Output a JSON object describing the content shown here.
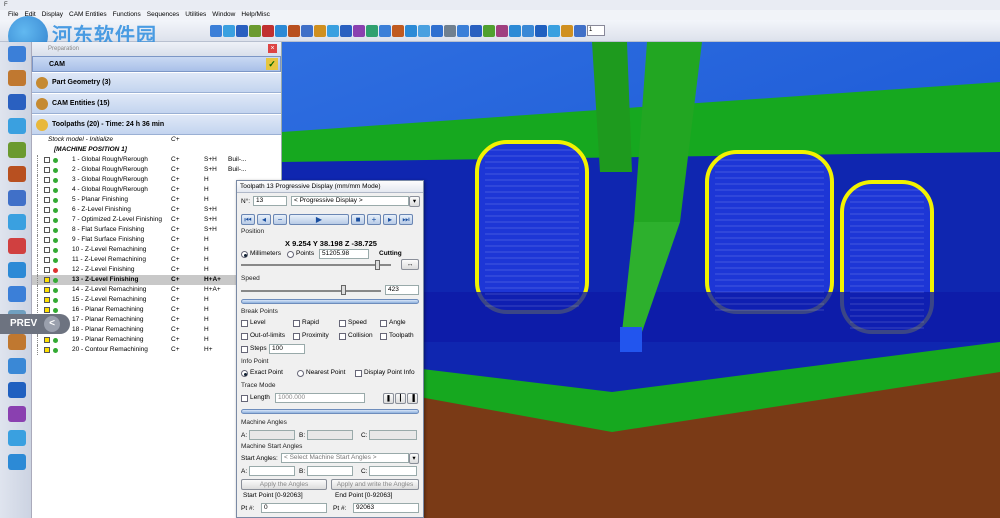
{
  "window": {
    "title_glyph": "F"
  },
  "menu": [
    "File",
    "Edit",
    "Display",
    "CAM Entities",
    "Functions",
    "Sequences",
    "Utilities",
    "Window",
    "Help/Misc"
  ],
  "toolbar": {
    "zoom_value": "1"
  },
  "watermark": {
    "title": "河东软件园",
    "url": "www.pc0359.cn"
  },
  "manager": {
    "header": "Preparation",
    "cam": "CAM",
    "groups": {
      "part_geometry": "Part Geometry (3)",
      "cam_entities": "CAM Entities (15)",
      "toolpaths": "Toolpaths (20) - Time: 24 h 36 min"
    },
    "stock": {
      "name": "Stock model - Initialize",
      "col": "C+"
    },
    "machine_position": "[MACHINE POSITION 1]",
    "rows": [
      {
        "name": "1 - Global Rough/Rerough",
        "c1": "C+",
        "c2": "S+H",
        "c3": "Buil-..."
      },
      {
        "name": "2 - Global Rough/Rerough",
        "c1": "C+",
        "c2": "S+H",
        "c3": "Buil-..."
      },
      {
        "name": "3 - Global Rough/Rerough",
        "c1": "C+",
        "c2": "H",
        "c3": ""
      },
      {
        "name": "4 - Global Rough/Rerough",
        "c1": "C+",
        "c2": "H",
        "c3": ""
      },
      {
        "name": "5 - Planar Finishing",
        "c1": "C+",
        "c2": "H",
        "c3": ""
      },
      {
        "name": "6 - Z-Level Finishing",
        "c1": "C+",
        "c2": "S+H",
        "c3": ""
      },
      {
        "name": "7 - Optimized Z-Level Finishing",
        "c1": "C+",
        "c2": "S+H",
        "c3": ""
      },
      {
        "name": "8 - Flat Surface Finishing",
        "c1": "C+",
        "c2": "S+H",
        "c3": ""
      },
      {
        "name": "9 - Flat Surface Finishing",
        "c1": "C+",
        "c2": "H",
        "c3": ""
      },
      {
        "name": "10 - Z-Level Remachining",
        "c1": "C+",
        "c2": "H",
        "c3": ""
      },
      {
        "name": "11 - Z-Level Remachining",
        "c1": "C+",
        "c2": "H",
        "c3": ""
      },
      {
        "name": "12 - Z-Level Finishing",
        "c1": "C+",
        "c2": "H",
        "c3": ""
      },
      {
        "name": "13 - Z-Level Finishing",
        "c1": "C+",
        "c2": "H+A+",
        "c3": ""
      },
      {
        "name": "14 - Z-Level Remachining",
        "c1": "C+",
        "c2": "H+A+",
        "c3": ""
      },
      {
        "name": "15 - Z-Level Remachining",
        "c1": "C+",
        "c2": "H",
        "c3": ""
      },
      {
        "name": "16 - Planar Remachining",
        "c1": "C+",
        "c2": "H",
        "c3": ""
      },
      {
        "name": "17 - Planar Remachining",
        "c1": "C+",
        "c2": "H",
        "c3": ""
      },
      {
        "name": "18 - Planar Remachining",
        "c1": "C+",
        "c2": "H",
        "c3": ""
      },
      {
        "name": "19 - Planar Remachining",
        "c1": "C+",
        "c2": "H",
        "c3": ""
      },
      {
        "name": "20 - Contour Remachining",
        "c1": "C+",
        "c2": "H+",
        "c3": ""
      }
    ]
  },
  "prev": {
    "label": "PREV",
    "arrow": "<"
  },
  "dialog": {
    "title": "Toolpath 13 Progressive Display (mm/mm Mode)",
    "n_label": "N°:",
    "n_value": "13",
    "mode_value": "< Progressive Display >",
    "position_label": "Position",
    "position_value": "X 9.254 Y 38.198 Z -38.725",
    "millimeters": "Millimeters",
    "points": "Points",
    "points_value": "51205.98",
    "cutting": "Cutting",
    "speed_label": "Speed",
    "speed_value": "423",
    "break_points": "Break Points",
    "bp": [
      "Level",
      "Rapid",
      "Speed",
      "Angle",
      "Out-of-limits",
      "Proximity",
      "Collision",
      "Toolpath"
    ],
    "steps_label": "Steps",
    "steps_value": "100",
    "info_point": "Info Point",
    "exact_point": "Exact Point",
    "nearest_point": "Nearest Point",
    "display_point_info": "Display Point Info",
    "trace_mode": "Trace Mode",
    "length_label": "Length",
    "length_value": "1000.000",
    "machine_angles": "Machine Angles",
    "a": "A:",
    "b": "B:",
    "c": "C:",
    "machine_start_angles": "Machine Start Angles",
    "start_angles_label": "Start Angles:",
    "start_angles_value": "< Select Machine Start Angles >",
    "apply_angles": "Apply the Angles",
    "apply_write": "Apply and write the Angles",
    "start_point": "Start Point [0-92063]",
    "end_point": "End Point [0-92063]",
    "pt_label": "Pt #:",
    "start_pt_value": "0",
    "end_pt_value": "92063"
  },
  "colors": {
    "part_blue": "#1d3fd6",
    "stock_green": "#18b020",
    "toolpath_yellow": "#f2f200",
    "tool_green": "#22a622"
  }
}
